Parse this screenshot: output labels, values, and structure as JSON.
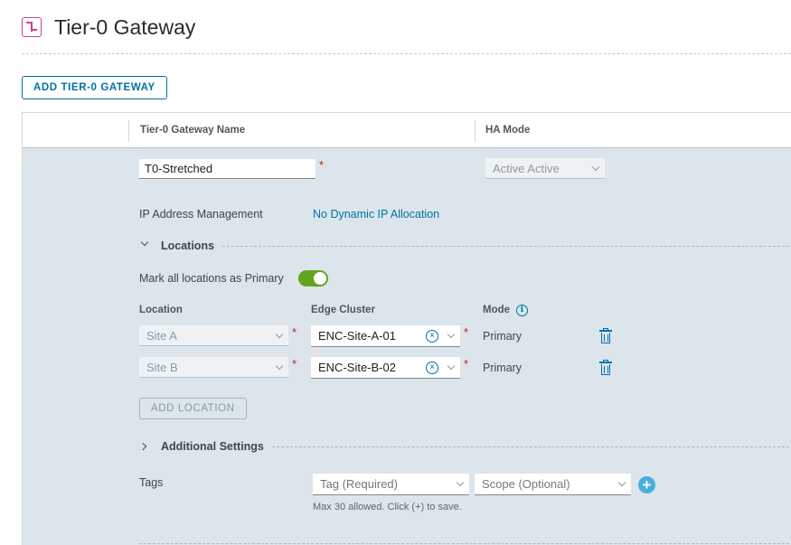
{
  "header": {
    "title": "Tier-0 Gateway",
    "icon": "gateway-icon"
  },
  "toolbar": {
    "add_gateway_label": "ADD TIER-0 GATEWAY"
  },
  "grid": {
    "columns": [
      "Tier-0 Gateway Name",
      "HA Mode"
    ]
  },
  "form": {
    "name_value": "T0-Stretched",
    "ha_mode_value": "Active Active",
    "ip_mgmt_label": "IP Address Management",
    "ip_mgmt_value": "No Dynamic IP Allocation",
    "locations_title": "Locations",
    "mark_primary_label": "Mark all locations as Primary",
    "mark_primary_on": true,
    "loc_headers": {
      "location": "Location",
      "edge_cluster": "Edge Cluster",
      "mode": "Mode"
    },
    "locations": [
      {
        "location": "Site A",
        "edge_cluster": "ENC-Site-A-01",
        "mode": "Primary"
      },
      {
        "location": "Site B",
        "edge_cluster": "ENC-Site-B-02",
        "mode": "Primary"
      }
    ],
    "add_location_label": "ADD LOCATION",
    "additional_settings_title": "Additional Settings",
    "tags_label": "Tags",
    "tag_placeholder": "Tag (Required)",
    "scope_placeholder": "Scope (Optional)",
    "tags_hint": "Max 30 allowed. Click (+) to save.",
    "required_mark": "*"
  }
}
